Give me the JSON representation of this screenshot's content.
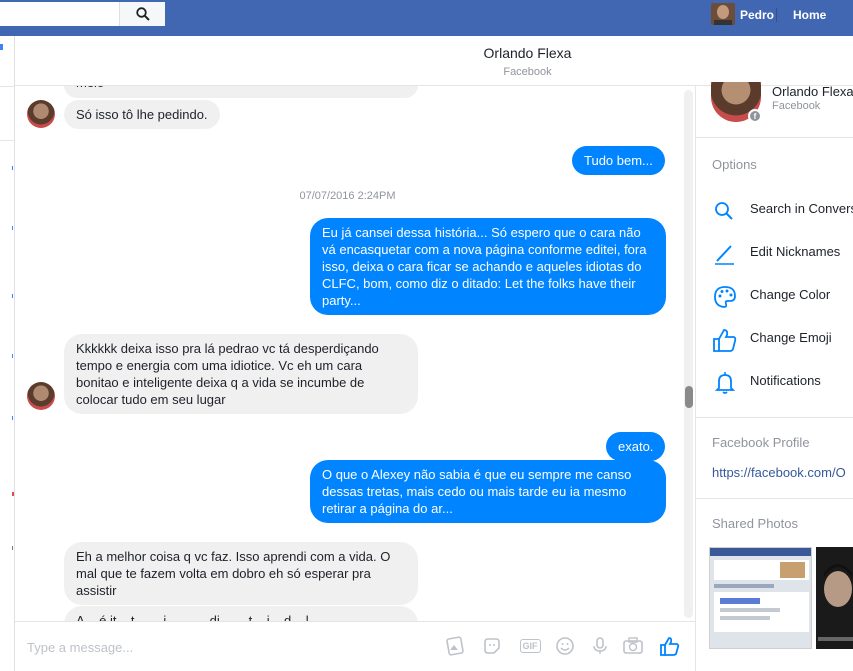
{
  "topbar": {
    "search_icon": "search-icon",
    "user_name": "Pedro",
    "home_label": "Home"
  },
  "conversation": {
    "title": "Orlando Flexa",
    "subtitle": "Facebook"
  },
  "messages": [
    {
      "dir": "in",
      "text": "meio"
    },
    {
      "dir": "in",
      "text": "Só isso tô lhe pedindo."
    },
    {
      "dir": "out",
      "text": "Tudo bem..."
    },
    {
      "dir": "out",
      "text": "Eu já cansei dessa história... Só espero que o cara não vá encasquetar com a nova página conforme editei, fora isso, deixa o cara ficar se achando e aqueles idiotas do CLFC, bom, como diz o ditado: Let the folks have their party..."
    },
    {
      "dir": "in",
      "text": "Kkkkkk deixa isso pra lá pedrao vc tá desperdiçando tempo e energia com uma idiotice. Vc eh um cara bonitao e inteligente deixa q a vida se incumbe de colocar tudo em seu lugar"
    },
    {
      "dir": "out",
      "text": "exato."
    },
    {
      "dir": "out",
      "text": "O que o Alexey não sabia é que eu sempre me canso dessas tretas, mais cedo ou mais tarde eu ia mesmo retirar a página do ar..."
    },
    {
      "dir": "in",
      "text": "Eh a melhor coisa q vc faz. Isso aprendi com a vida. O mal que te fazem volta em dobro eh só esperar pra assistir"
    },
    {
      "dir": "in",
      "text": "A... é it... t... ... i... ... ... di... ... t... i... d... l..."
    }
  ],
  "timestamp": "07/07/2016 2:24PM",
  "composer": {
    "placeholder": "Type a message...",
    "icons": [
      "photo-icon",
      "sticker-icon",
      "gif-icon",
      "emoji-icon",
      "microphone-icon",
      "camera-icon",
      "like-icon"
    ],
    "gif_label": "GIF"
  },
  "right_panel": {
    "name": "Orlando Flexa",
    "source": "Facebook",
    "badge": "f",
    "options_heading": "Options",
    "options": [
      {
        "label": "Search in Conversation",
        "icon": "search-icon"
      },
      {
        "label": "Edit Nicknames",
        "icon": "pencil-icon"
      },
      {
        "label": "Change Color",
        "icon": "palette-icon"
      },
      {
        "label": "Change Emoji",
        "icon": "thumbs-up-icon"
      },
      {
        "label": "Notifications",
        "icon": "bell-icon"
      }
    ],
    "profile_heading": "Facebook Profile",
    "profile_link": "https://facebook.com/O",
    "photos_heading": "Shared Photos"
  },
  "colors": {
    "brand": "#4267b2",
    "outgoing_bubble": "#0084ff",
    "incoming_bubble": "#f1f0f0",
    "link": "#365899"
  }
}
